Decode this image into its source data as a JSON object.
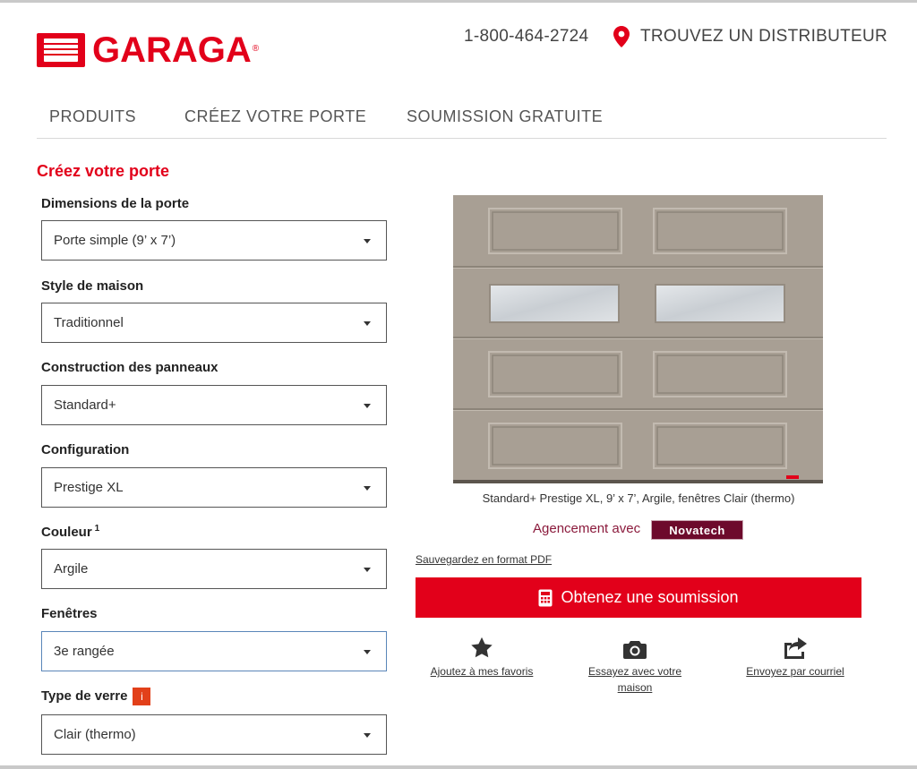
{
  "header": {
    "logo_text": "GARAGA",
    "logo_reg": "®",
    "phone": "1-800-464-2724",
    "find_dealer": "TROUVEZ UN DISTRIBUTEUR"
  },
  "nav": {
    "items": [
      {
        "label": "PRODUITS"
      },
      {
        "label": "CRÉEZ VOTRE PORTE"
      },
      {
        "label": "SOUMISSION GRATUITE"
      }
    ]
  },
  "form": {
    "title": "Créez votre porte",
    "fields": [
      {
        "label": "Dimensions de la porte",
        "value": "Porte simple (9’ x 7’)"
      },
      {
        "label": "Style de maison",
        "value": "Traditionnel"
      },
      {
        "label": "Construction des panneaux",
        "value": "Standard+"
      },
      {
        "label": "Configuration",
        "value": "Prestige XL"
      },
      {
        "label": "Couleur",
        "sup": "1",
        "value": "Argile"
      },
      {
        "label": "Fenêtres",
        "value": "3e rangée"
      },
      {
        "label": "Type de verre",
        "info": "i",
        "value": "Clair (thermo)"
      }
    ]
  },
  "preview": {
    "caption": "Standard+ Prestige XL, 9’ x 7’, Argile, fenêtres Clair (thermo)",
    "agencement": "Agencement avec",
    "novatech": "Novatech",
    "pdf_link": "Sauvegardez en format PDF",
    "quote_button": "Obtenez une soumission"
  },
  "actions": [
    {
      "label": "Ajoutez à mes favoris",
      "icon": "star-icon"
    },
    {
      "label": "Essayez avec votre maison",
      "icon": "camera-icon"
    },
    {
      "label": "Envoyez par courriel",
      "icon": "share-icon"
    }
  ],
  "colors": {
    "brand": "#e2001a",
    "door": "#a89f94",
    "novatech": "#6d0a2c"
  }
}
